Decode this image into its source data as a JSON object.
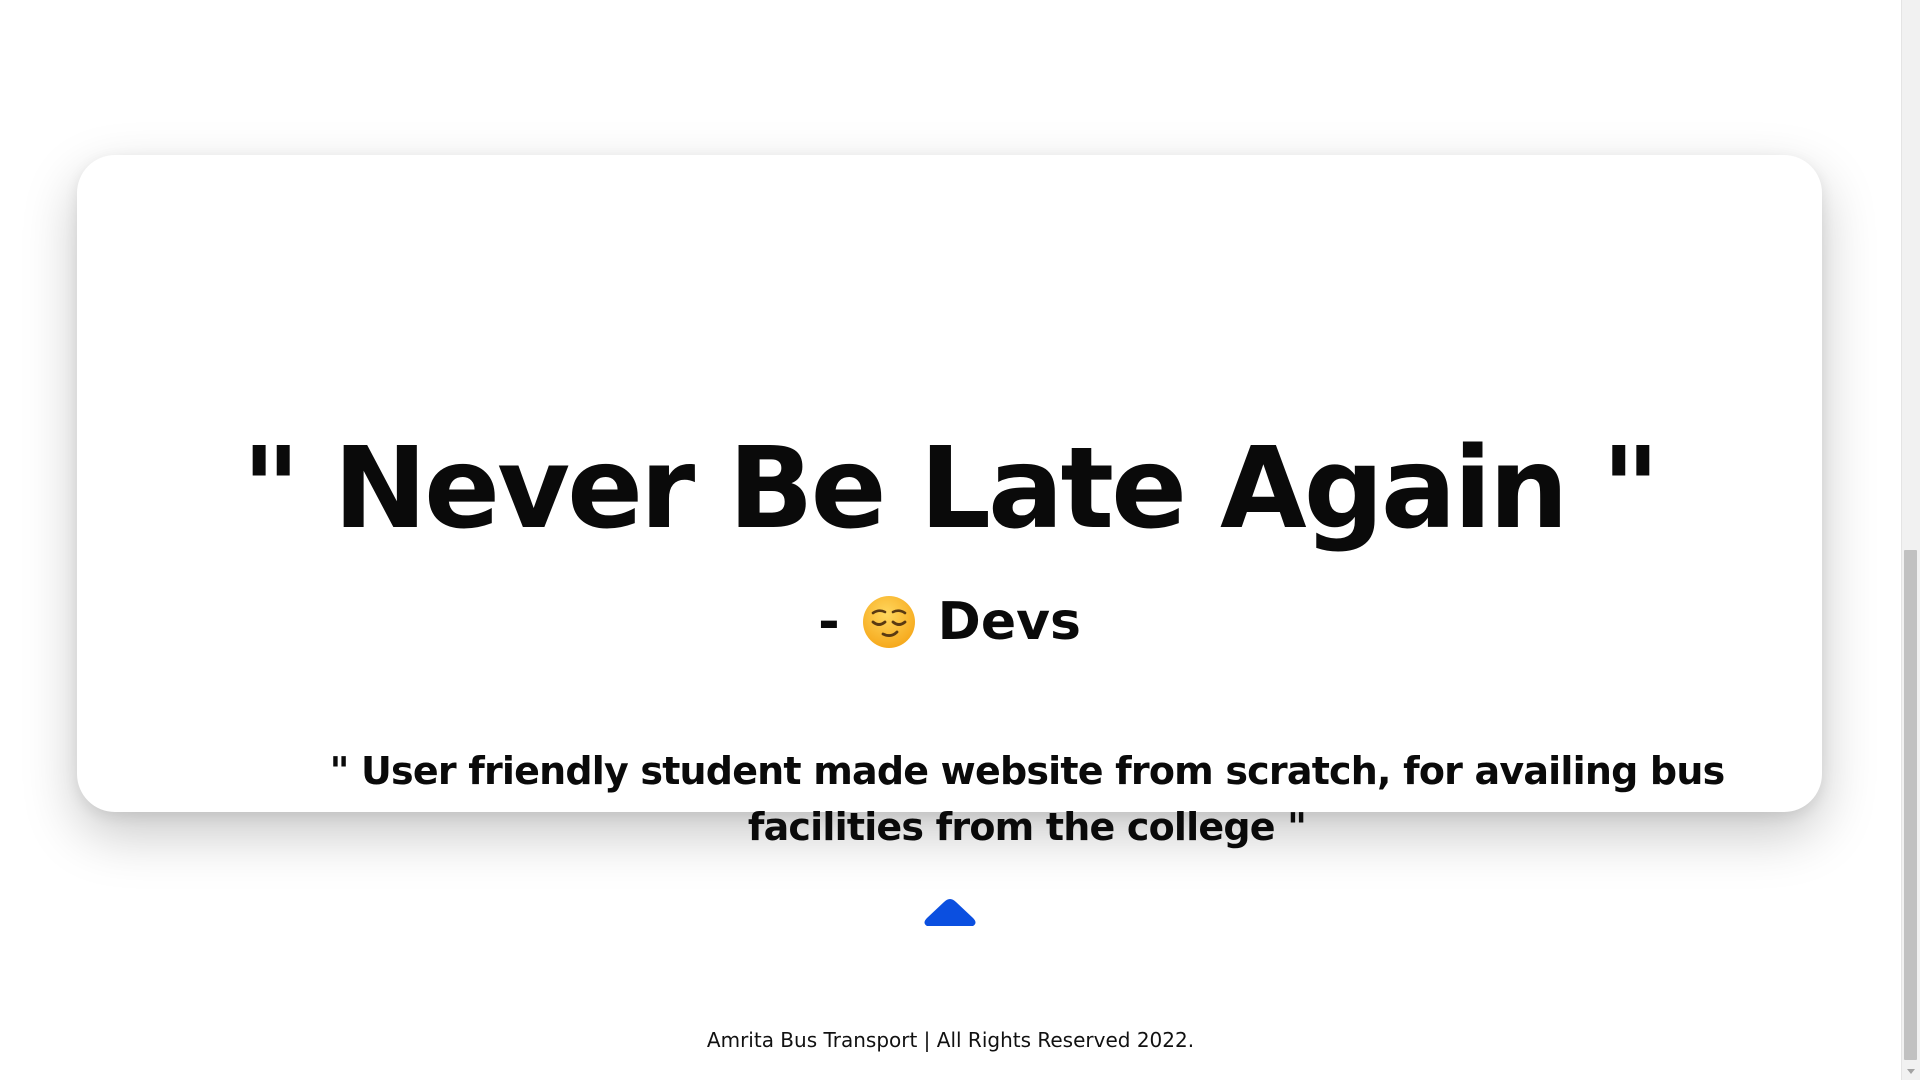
{
  "hero": {
    "headline": "\" Never Be Late Again \"",
    "attribution_dash": "-",
    "attribution_emoji": "relieved-face-icon",
    "attribution_name": "Devs",
    "tagline": "\" User friendly student made website from scratch, for availing bus facilities from the college \""
  },
  "scroll_top": {
    "icon": "chevron-up-icon",
    "color": "#0b4fe0"
  },
  "footer": {
    "text": "Amrita Bus Transport | All Rights Reserved 2022."
  }
}
